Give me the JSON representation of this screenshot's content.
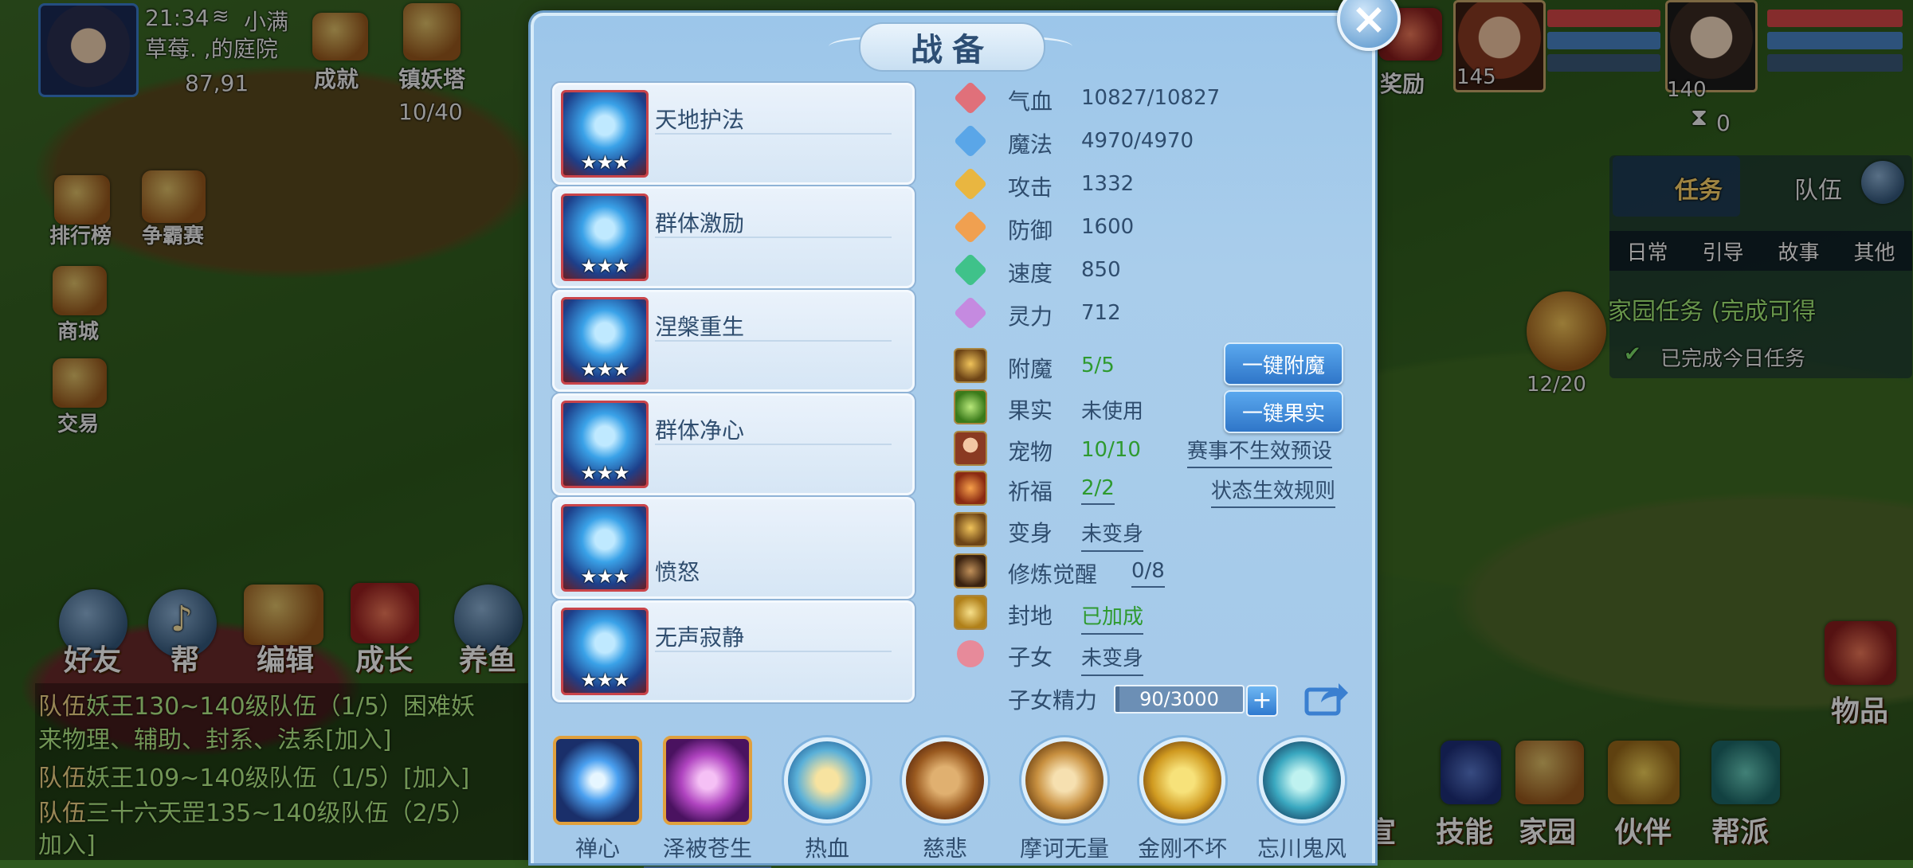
{
  "status_bar": {
    "time": "21:34",
    "carrier": "小满",
    "location": "草莓.  ,的庭院",
    "coords": "87,91"
  },
  "hud_top": {
    "achievement": "成就",
    "tower": "镇妖塔",
    "tower_progress": "10/40",
    "reward": "奖励",
    "player_level_1": "145",
    "player_level_2": "140",
    "counter": "0"
  },
  "hud_left": {
    "ranking": "排行榜",
    "contest": "争霸赛",
    "mall": "商城",
    "trade": "交易"
  },
  "hud_bottom": {
    "friends": "好友",
    "help": "帮",
    "edit": "编辑",
    "growth": "成长",
    "fish": "养鱼",
    "skills": "技能",
    "home": "家园",
    "partner": "伙伴",
    "guild": "帮派",
    "items": "物品",
    "shop_partial": "宣"
  },
  "chat": [
    {
      "tag": "队伍",
      "text": "妖王130~140级队伍（1/5）困难妖"
    },
    {
      "tag": "",
      "text": "来物理、辅助、封系、法系[加入]"
    },
    {
      "tag": "队伍",
      "text": "妖王109~140级队伍（1/5）[加入]"
    },
    {
      "tag": "队伍",
      "text": "三十六天罡135~140级队伍（2/5）"
    },
    {
      "tag": "",
      "text": "加入]"
    }
  ],
  "right_panel": {
    "tab_task": "任务",
    "tab_team": "队伍",
    "subtabs": [
      "日常",
      "引导",
      "故事",
      "其他"
    ],
    "home_task": "家园任务 (完成可得",
    "home_task_done": "已完成今日任务",
    "pet_count": "12/20"
  },
  "dialog": {
    "title": "战备",
    "close": "×",
    "skills": [
      {
        "name": "天地护法",
        "stars": "★★★"
      },
      {
        "name": "群体激励",
        "stars": "★★★"
      },
      {
        "name": "涅槃重生",
        "stars": "★★★"
      },
      {
        "name": "群体净心",
        "stars": "★★★"
      },
      {
        "name": "愤怒",
        "stars": "★★★"
      },
      {
        "name": "无声寂静",
        "stars": "★★★"
      }
    ],
    "stats": [
      {
        "label": "气血",
        "value": "10827/10827",
        "color": "#e0707a"
      },
      {
        "label": "魔法",
        "value": "4970/4970",
        "color": "#5aa6e8"
      },
      {
        "label": "攻击",
        "value": "1332",
        "color": "#e9b640"
      },
      {
        "label": "防御",
        "value": "1600",
        "color": "#f0a050"
      },
      {
        "label": "速度",
        "value": "850",
        "color": "#3fc28a"
      },
      {
        "label": "灵力",
        "value": "712",
        "color": "#c58ae0"
      }
    ],
    "extras": [
      {
        "label": "附魔",
        "value": "5/5"
      },
      {
        "label": "果实",
        "value": "未使用"
      },
      {
        "label": "宠物",
        "value": "10/10"
      },
      {
        "label": "祈福",
        "value": "2/2"
      },
      {
        "label": "变身",
        "value": "未变身"
      },
      {
        "label": "修炼觉醒",
        "value": "0/8"
      },
      {
        "label": "封地",
        "value": "已加成"
      },
      {
        "label": "子女",
        "value": "未变身"
      }
    ],
    "btn_enchant": "一键附魔",
    "btn_fruit": "一键果实",
    "link_preset": "赛事不生效预设",
    "link_rules": "状态生效规则",
    "energy_label": "子女精力",
    "energy_value": "90/3000",
    "energy_fraction": 0.03,
    "plus": "+",
    "bottom_skills": [
      "禅心",
      "泽被苍生",
      "热血",
      "慈悲",
      "摩诃无量",
      "金刚不坏",
      "忘川鬼风"
    ]
  }
}
